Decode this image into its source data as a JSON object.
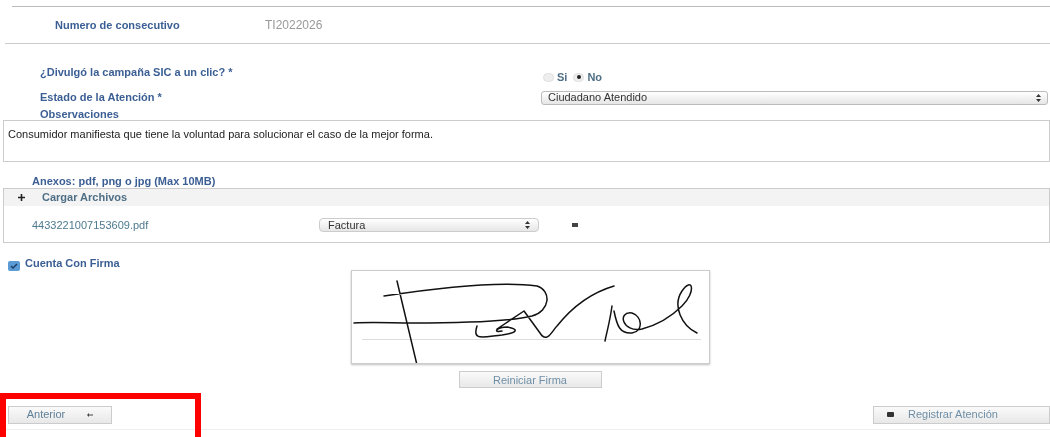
{
  "consecutive": {
    "label": "Numero de consecutivo",
    "value": "TI2022026"
  },
  "campaign": {
    "label": "¿Divulgó la campaña SIC a un clic? *",
    "options": [
      {
        "label": "Si",
        "selected": false
      },
      {
        "label": "No",
        "selected": true
      }
    ]
  },
  "status": {
    "label": "Estado de la Atención *",
    "value": "Ciudadano Atendido"
  },
  "observations": {
    "label": "Observaciones",
    "value": "Consumidor manifiesta que tiene la voluntad para solucionar el caso de la mejor forma."
  },
  "attachments": {
    "label": "Anexos: pdf, png o jpg (Max 10MB)",
    "upload_label": "Cargar Archivos",
    "files": [
      {
        "name": "4433221007153609.pdf",
        "type": "Factura"
      }
    ]
  },
  "signature": {
    "label": "Cuenta Con Firma",
    "checked": true,
    "reset_button": "Reiniciar Firma"
  },
  "buttons": {
    "previous": "Anterior",
    "register": "Registrar Atención"
  }
}
